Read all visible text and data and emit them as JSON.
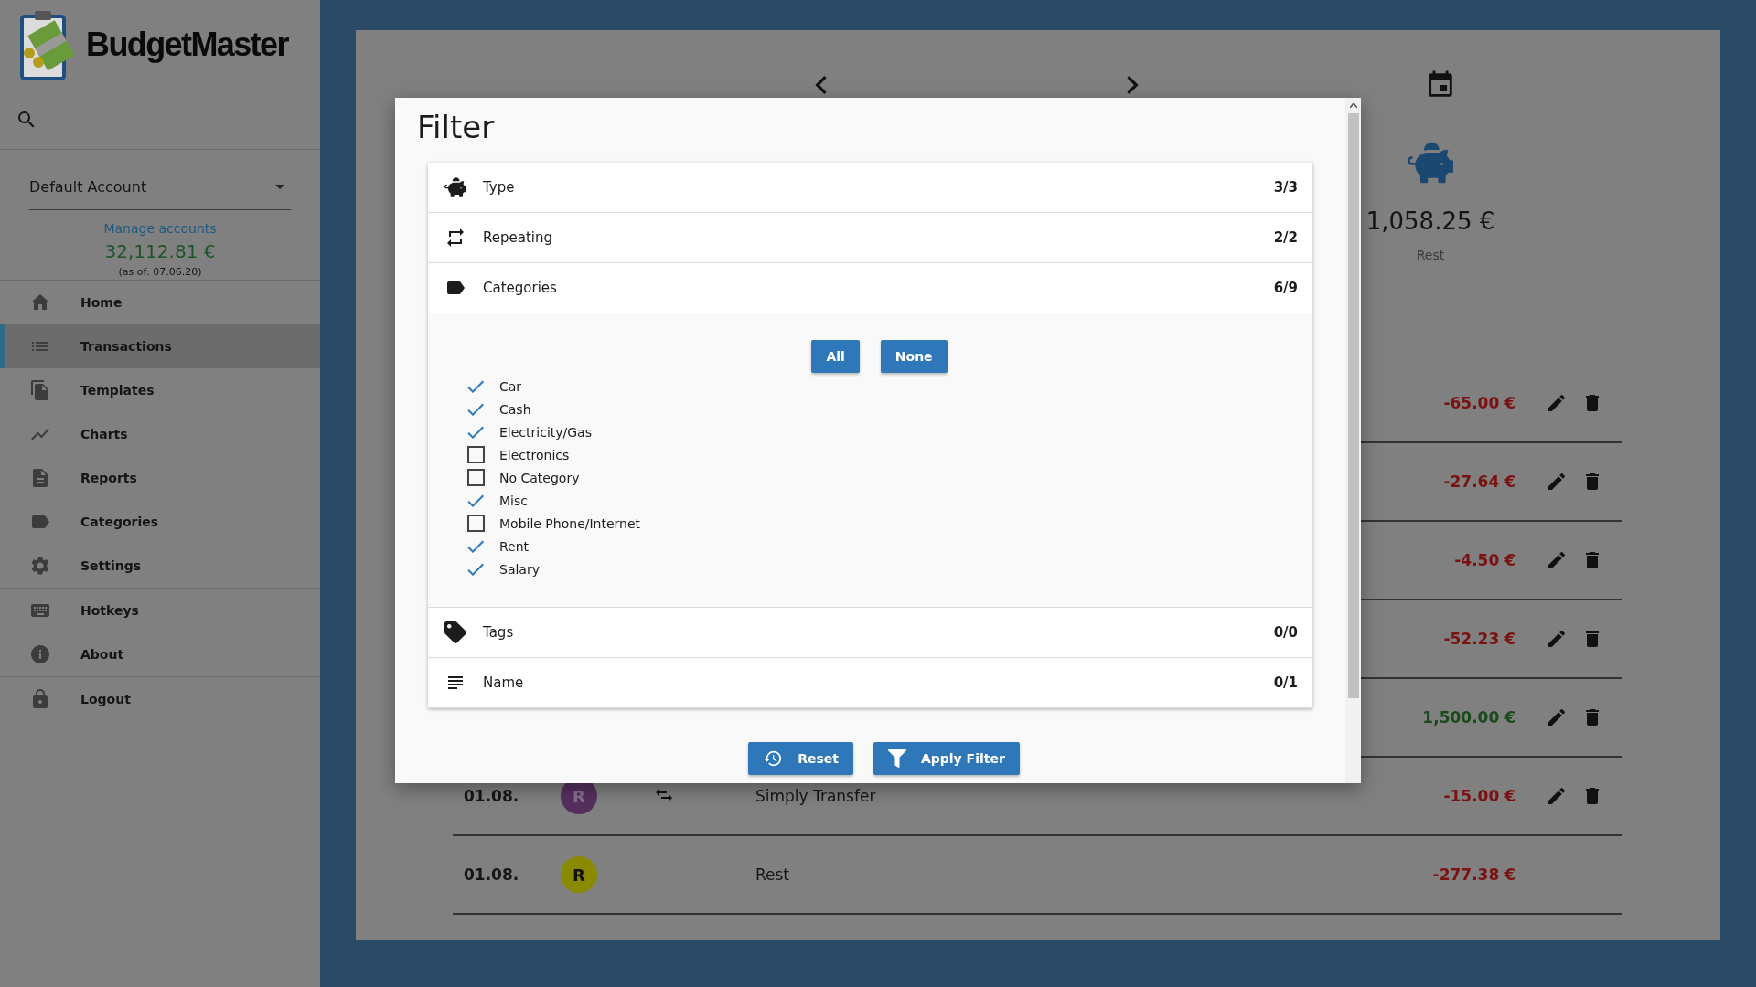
{
  "sidebar": {
    "app_name": "BudgetMaster",
    "account": {
      "value": "Default Account"
    },
    "manage_link": "Manage accounts",
    "balance": "32,112.81 €",
    "balance_date": "(as of: 07.06.20)",
    "items": [
      {
        "label": "Home",
        "selected": false
      },
      {
        "label": "Transactions",
        "selected": true
      },
      {
        "label": "Templates",
        "selected": false
      },
      {
        "label": "Charts",
        "selected": false
      },
      {
        "label": "Reports",
        "selected": false
      },
      {
        "label": "Categories",
        "selected": false
      },
      {
        "label": "Settings",
        "selected": false
      },
      {
        "label": "Hotkeys",
        "selected": false
      },
      {
        "label": "About",
        "selected": false
      },
      {
        "label": "Logout",
        "selected": false
      }
    ]
  },
  "summary": {
    "amount": "1,058.25 €",
    "label": "Rest"
  },
  "transactions": [
    {
      "amount": "-65.00 €",
      "income": false
    },
    {
      "amount": "-27.64 €",
      "income": false
    },
    {
      "amount": "-4.50 €",
      "income": false
    },
    {
      "amount": "-52.23 €",
      "income": false
    },
    {
      "amount": "1,500.00 €",
      "income": true
    },
    {
      "date": "01.08.",
      "avatar": "R",
      "color": "#55305f",
      "transfer": true,
      "name": "Simply Transfer",
      "amount": "-15.00 €",
      "income": false,
      "editable": true
    },
    {
      "date": "01.08.",
      "avatar": "R",
      "color": "#8a8a00",
      "transfer": false,
      "name": "Rest",
      "amount": "-277.38 €",
      "income": false,
      "editable": false
    }
  ],
  "filter": {
    "title": "Filter",
    "sections": [
      {
        "label": "Type",
        "count": "3/3"
      },
      {
        "label": "Repeating",
        "count": "2/2"
      },
      {
        "label": "Categories",
        "count": "6/9",
        "buttons": [
          "All",
          "None"
        ],
        "items": [
          {
            "label": "Car",
            "checked": true
          },
          {
            "label": "Cash",
            "checked": true
          },
          {
            "label": "Electricity/Gas",
            "checked": true
          },
          {
            "label": "Electronics",
            "checked": false
          },
          {
            "label": "No Category",
            "checked": false
          },
          {
            "label": "Misc",
            "checked": true
          },
          {
            "label": "Mobile Phone/Internet",
            "checked": false
          },
          {
            "label": "Rent",
            "checked": true
          },
          {
            "label": "Salary",
            "checked": true
          }
        ]
      },
      {
        "label": "Tags",
        "count": "0/0"
      },
      {
        "label": "Name",
        "count": "0/1"
      }
    ],
    "reset_button": "Reset",
    "apply_button": "Apply Filter"
  }
}
